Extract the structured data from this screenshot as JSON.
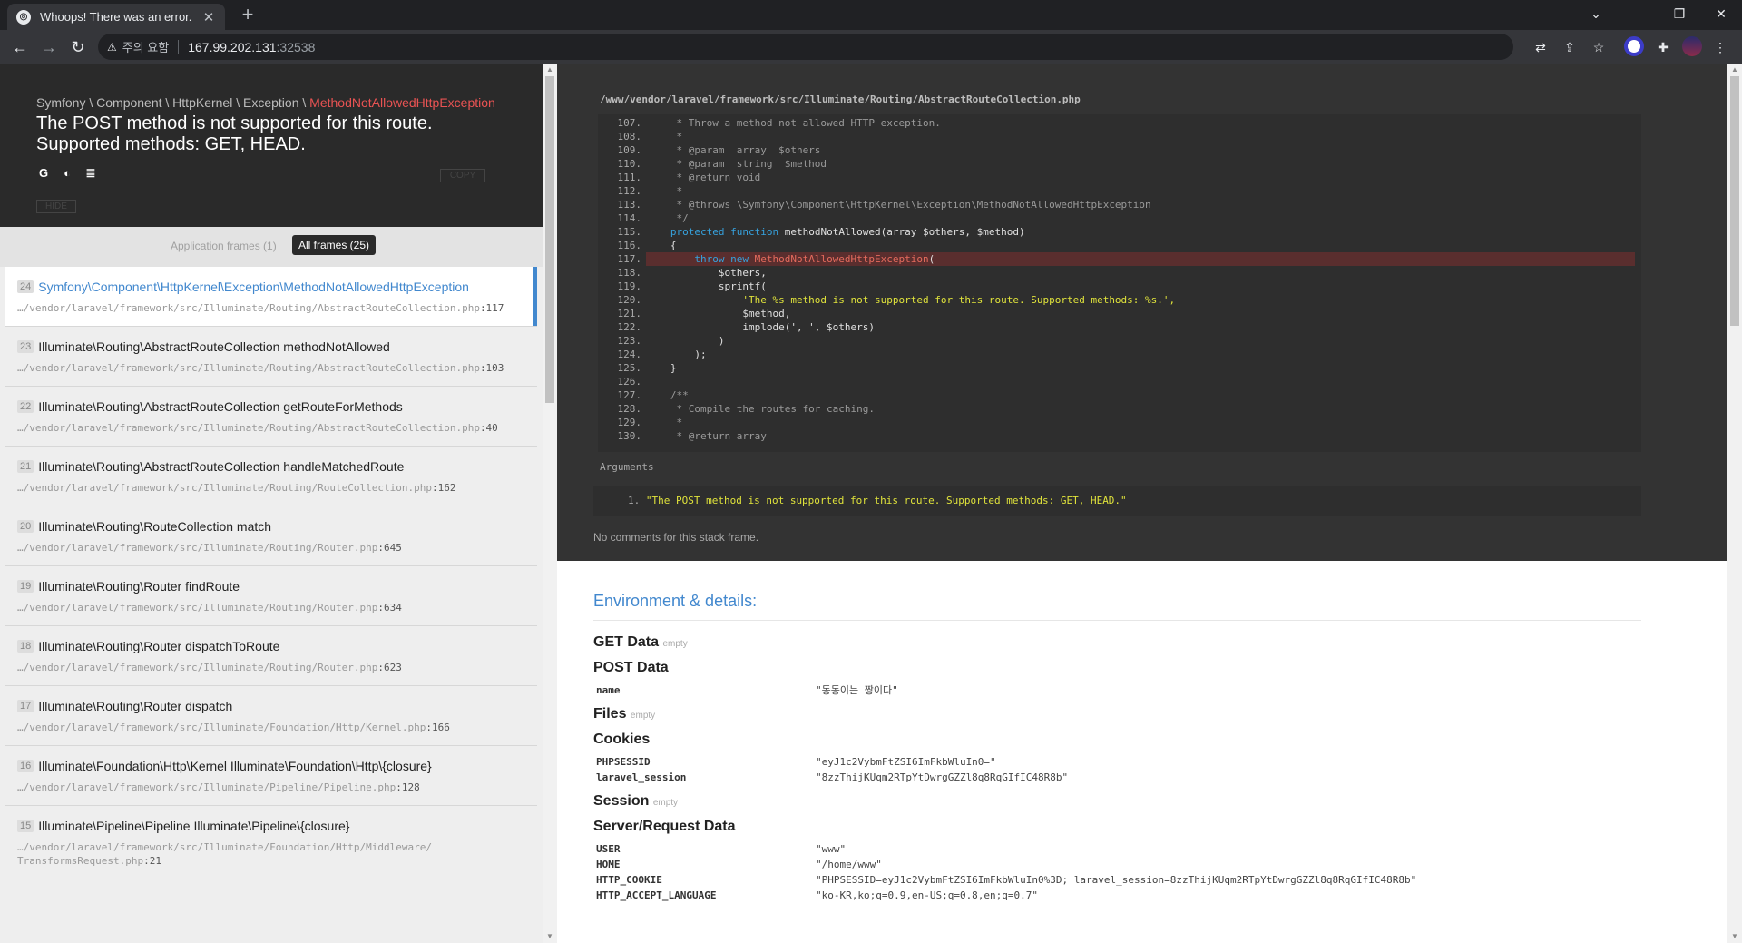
{
  "browser": {
    "tab_title": "Whoops! There was an error.",
    "tab_close": "✕",
    "new_tab": "+",
    "security_label": "주의 요함",
    "url_host": "167.99.202.131",
    "url_port": ":32538",
    "icons": [
      "back-icon",
      "forward-icon",
      "reload-icon",
      "warning-icon",
      "translate-icon",
      "share-icon",
      "bookmark-star-icon",
      "extension-icon",
      "extensions-puzzle-icon",
      "profile-avatar",
      "menu-dots-icon"
    ]
  },
  "exception": {
    "namespace": "Symfony \\ Component \\ HttpKernel \\ Exception \\ ",
    "class": "MethodNotAllowedHttpException",
    "message": "The POST method is not supported for this route. Supported methods: GET, HEAD.",
    "copy_label": "COPY",
    "hide_label": "HIDE"
  },
  "frame_filter": {
    "application": "Application frames (1)",
    "all": "All frames (25)"
  },
  "frames": [
    {
      "idx": "24",
      "cls": "Symfony\\Component\\HttpKernel\\Exception\\MethodNotAllowedHttpException",
      "file": "…/vendor/laravel/framework/src/Illuminate/Routing/AbstractRouteCollection.php",
      "line": ":117"
    },
    {
      "idx": "23",
      "cls": "Illuminate\\Routing\\AbstractRouteCollection methodNotAllowed",
      "file": "…/vendor/laravel/framework/src/Illuminate/Routing/AbstractRouteCollection.php",
      "line": ":103"
    },
    {
      "idx": "22",
      "cls": "Illuminate\\Routing\\AbstractRouteCollection getRouteForMethods",
      "file": "…/vendor/laravel/framework/src/Illuminate/Routing/AbstractRouteCollection.php",
      "line": ":40"
    },
    {
      "idx": "21",
      "cls": "Illuminate\\Routing\\AbstractRouteCollection handleMatchedRoute",
      "file": "…/vendor/laravel/framework/src/Illuminate/Routing/RouteCollection.php",
      "line": ":162"
    },
    {
      "idx": "20",
      "cls": "Illuminate\\Routing\\RouteCollection match",
      "file": "…/vendor/laravel/framework/src/Illuminate/Routing/Router.php",
      "line": ":645"
    },
    {
      "idx": "19",
      "cls": "Illuminate\\Routing\\Router findRoute",
      "file": "…/vendor/laravel/framework/src/Illuminate/Routing/Router.php",
      "line": ":634"
    },
    {
      "idx": "18",
      "cls": "Illuminate\\Routing\\Router dispatchToRoute",
      "file": "…/vendor/laravel/framework/src/Illuminate/Routing/Router.php",
      "line": ":623"
    },
    {
      "idx": "17",
      "cls": "Illuminate\\Routing\\Router dispatch",
      "file": "…/vendor/laravel/framework/src/Illuminate/Foundation/Http/Kernel.php",
      "line": ":166"
    },
    {
      "idx": "16",
      "cls": "Illuminate\\Foundation\\Http\\Kernel Illuminate\\Foundation\\Http\\{closure}",
      "file": "…/vendor/laravel/framework/src/Illuminate/Pipeline/Pipeline.php",
      "line": ":128"
    },
    {
      "idx": "15",
      "cls": "Illuminate\\Pipeline\\Pipeline Illuminate\\Pipeline\\{closure}",
      "file": "…/vendor/laravel/framework/src/Illuminate/Foundation/Http/Middleware/ TransformsRequest.php",
      "line": ":21"
    }
  ],
  "code": {
    "path": "/www/vendor/laravel/framework/src/Illuminate/Routing/AbstractRouteCollection.php",
    "lines": [
      {
        "n": "107.",
        "t": "    * Throw a method not allowed HTTP exception.",
        "k": "com"
      },
      {
        "n": "108.",
        "t": "    *",
        "k": "com"
      },
      {
        "n": "109.",
        "t": "    * @param  array  $others",
        "k": "com"
      },
      {
        "n": "110.",
        "t": "    * @param  string  $method",
        "k": "com"
      },
      {
        "n": "111.",
        "t": "    * @return void",
        "k": "com"
      },
      {
        "n": "112.",
        "t": "    *",
        "k": "com"
      },
      {
        "n": "113.",
        "t": "    * @throws \\Symfony\\Component\\HttpKernel\\Exception\\MethodNotAllowedHttpException",
        "k": "com"
      },
      {
        "n": "114.",
        "t": "    */",
        "k": "com"
      },
      {
        "n": "115.",
        "t": "   protected function methodNotAllowed(array $others, $method)",
        "k": "fn"
      },
      {
        "n": "116.",
        "t": "   {",
        "k": "plain"
      },
      {
        "n": "117.",
        "t": "       throw new MethodNotAllowedHttpException(",
        "k": "throw"
      },
      {
        "n": "118.",
        "t": "           $others,",
        "k": "plain"
      },
      {
        "n": "119.",
        "t": "           sprintf(",
        "k": "plain"
      },
      {
        "n": "120.",
        "t": "               'The %s method is not supported for this route. Supported methods: %s.',",
        "k": "str"
      },
      {
        "n": "121.",
        "t": "               $method,",
        "k": "plain"
      },
      {
        "n": "122.",
        "t": "               implode(', ', $others)",
        "k": "plain"
      },
      {
        "n": "123.",
        "t": "           )",
        "k": "plain"
      },
      {
        "n": "124.",
        "t": "       );",
        "k": "plain"
      },
      {
        "n": "125.",
        "t": "   }",
        "k": "plain"
      },
      {
        "n": "126.",
        "t": "",
        "k": "plain"
      },
      {
        "n": "127.",
        "t": "   /**",
        "k": "com"
      },
      {
        "n": "128.",
        "t": "    * Compile the routes for caching.",
        "k": "com"
      },
      {
        "n": "129.",
        "t": "    *",
        "k": "com"
      },
      {
        "n": "130.",
        "t": "    * @return array",
        "k": "com"
      }
    ],
    "error_line": "117."
  },
  "arguments": {
    "label": "Arguments",
    "item_num": "1.",
    "item_value": "\"The POST method is not supported for this route. Supported methods: GET, HEAD.\"",
    "no_comments": "No comments for this stack frame."
  },
  "env": {
    "title": "Environment & details:",
    "empty_label": "empty",
    "get_data": "GET Data",
    "post_data": "POST Data",
    "post_rows": [
      {
        "k": "name",
        "v": "\"동동이는 짱이다\""
      }
    ],
    "files": "Files",
    "cookies": "Cookies",
    "cookie_rows": [
      {
        "k": "PHPSESSID",
        "v": "\"eyJ1c2VybmFtZSI6ImFkbWluIn0=\""
      },
      {
        "k": "laravel_session",
        "v": "\"8zzThijKUqm2RTpYtDwrgGZZl8q8RqGIfIC48R8b\""
      }
    ],
    "session": "Session",
    "server": "Server/Request Data",
    "server_rows": [
      {
        "k": "USER",
        "v": "\"www\""
      },
      {
        "k": "HOME",
        "v": "\"/home/www\""
      },
      {
        "k": "HTTP_COOKIE",
        "v": "\"PHPSESSID=eyJ1c2VybmFtZSI6ImFkbWluIn0%3D; laravel_session=8zzThijKUqm2RTpYtDwrgGZZl8q8RqGIfIC48R8b\""
      },
      {
        "k": "HTTP_ACCEPT_LANGUAGE",
        "v": "\"ko-KR,ko;q=0.9,en-US;q=0.8,en;q=0.7\""
      }
    ]
  },
  "colors": {
    "accent": "#4288ce",
    "error": "#e95353",
    "code_bg": "#333333"
  }
}
